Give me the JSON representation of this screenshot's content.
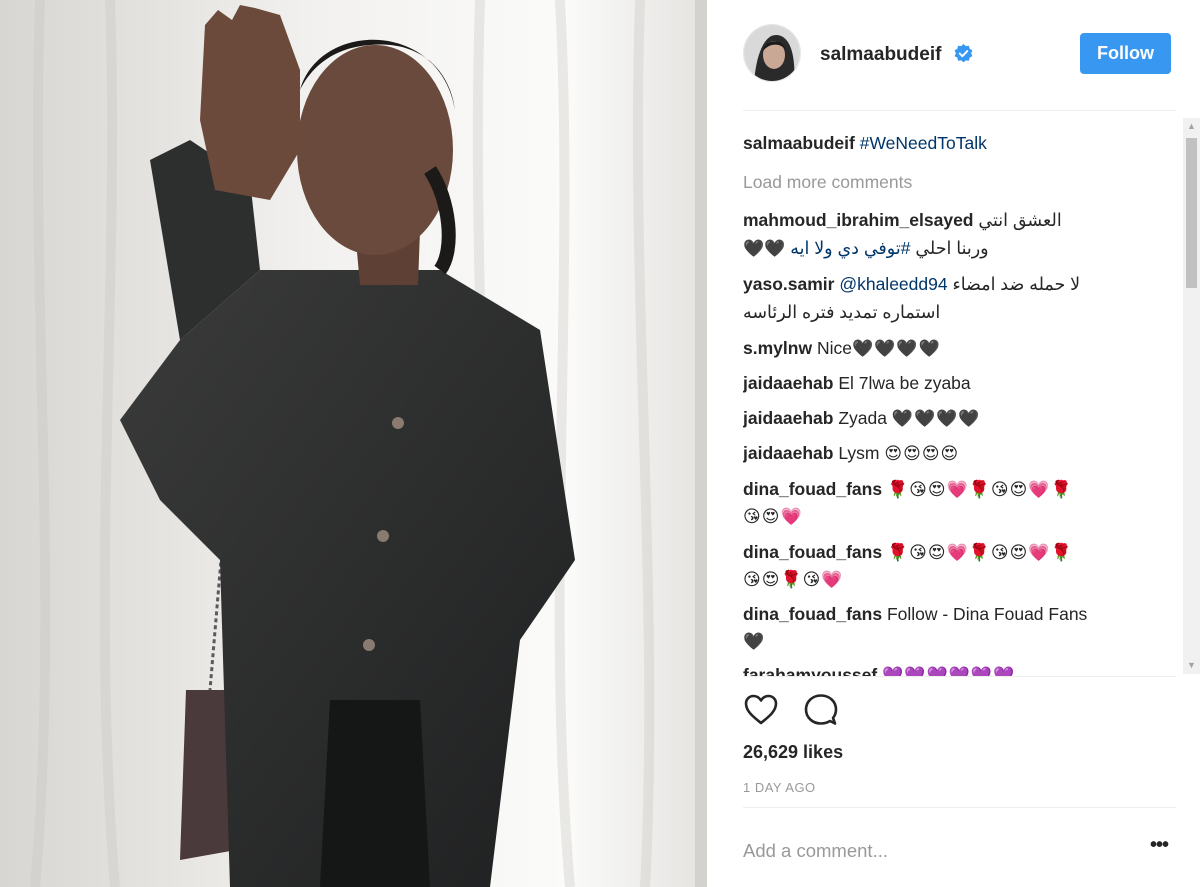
{
  "post": {
    "username": "salmaabudeif",
    "follow_label": "Follow",
    "caption_user": "salmaabudeif",
    "caption_tag": "#WeNeedToTalk",
    "load_more": "Load more comments",
    "likes": "26,629 likes",
    "time": "1 DAY AGO",
    "add_comment_placeholder": "Add a comment...",
    "more_icon": "•••"
  },
  "comments": [
    {
      "user": "mahmoud_ibrahim_elsayed",
      "line1": "العشق انتي",
      "line2_a": "وربنا احلي",
      "line2_tag": "#توفي دي ولا ايه",
      "line2_emoji": "🖤🖤"
    },
    {
      "user": "yaso.samir",
      "mention": "@khaleedd94",
      "line1": "لا حمله ضد امضاء",
      "line2": "استماره تمديد فتره الرئاسه"
    },
    {
      "user": "s.mylnw",
      "text": "Nice",
      "emoji": "🖤🖤🖤🖤"
    },
    {
      "user": "jaidaaehab",
      "text": "El 7lwa be zyaba"
    },
    {
      "user": "jaidaaehab",
      "text": "Zyada",
      "emoji": "🖤🖤🖤🖤"
    },
    {
      "user": "jaidaaehab",
      "text": "Lysm",
      "emoji": "😍😍😍😍"
    },
    {
      "user": "dina_fouad_fans",
      "emoji": "🌹😘😍💗🌹😘😍💗🌹",
      "emoji2": "😘😍💗"
    },
    {
      "user": "dina_fouad_fans",
      "emoji": "🌹😘😍💗🌹😘😍💗🌹",
      "emoji2": "😘😍🌹😘💗"
    },
    {
      "user": "dina_fouad_fans",
      "text": "Follow - Dina Fouad Fans",
      "emoji2": "🖤"
    },
    {
      "user": "farahamyoussef",
      "emoji": "💜💜💜💜💜💜"
    }
  ],
  "icons": {
    "avatar": "avatar",
    "verified": "verified-badge-icon",
    "like": "heart-icon",
    "comment": "comment-bubble-icon",
    "more": "more-options-icon"
  },
  "colors": {
    "follow_button": "#3897f0",
    "hashtag": "#003569",
    "muted": "#999999",
    "text": "#262626"
  }
}
